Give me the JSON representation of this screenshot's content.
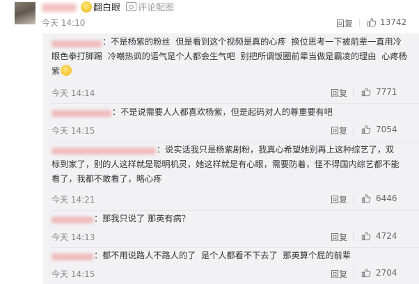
{
  "top_comment": {
    "emoji": "smiley",
    "label": "翻白眼",
    "action_label": "评论配图",
    "time": "今天 14:10",
    "reply_label": "回复",
    "like_count": "13742"
  },
  "replies": [
    {
      "line1": "：不是杨紫的粉丝  但是看到这个视频是真的心疼  换位思考一下被前辈一直用冷",
      "line2": "眼色拳打脚踢  冷嘲热讽的语气是个人都会生气吧  别把所谓饭圈前辈当做是霸凌的理由  心疼杨",
      "line3": "紫",
      "time": "今天 14:14",
      "reply_label": "回复",
      "like_count": "7771"
    },
    {
      "line1": "：不是说需要人人都喜欢杨紫，但是起码对人的尊重要有吧",
      "time": "今天 14:15",
      "reply_label": "回复",
      "like_count": "7054"
    },
    {
      "line1": "：说实话我只是杨紫剧粉，我真心希望她别再上这种综艺了，双",
      "line2": "标到家了，别的人这样就是聪明机灵，她这样就是有心眼，需要防着，怪不得国内综艺都不能",
      "line3": "看了，我都不敢看了，略心疼",
      "time": "今天 14:21",
      "reply_label": "回复",
      "like_count": "6446"
    },
    {
      "line1": "：那我只说了 那英有病？",
      "time": "今天 14:13",
      "reply_label": "回复",
      "like_count": "4724"
    },
    {
      "line1": "：都不用说路人不路人的了  是个人都看不下去了  那英算个屁的前辈",
      "time": "今天 14:15",
      "reply_label": "回复",
      "like_count": "2704"
    }
  ],
  "colors": {
    "panel_bg": "#f2f2f5",
    "text": "#333333",
    "muted": "#888888",
    "blur_name": "#f0bcbc"
  },
  "icons": {
    "like": "thumbs-up-icon",
    "picture": "picture-icon",
    "emoji": "smiley-emoji"
  }
}
